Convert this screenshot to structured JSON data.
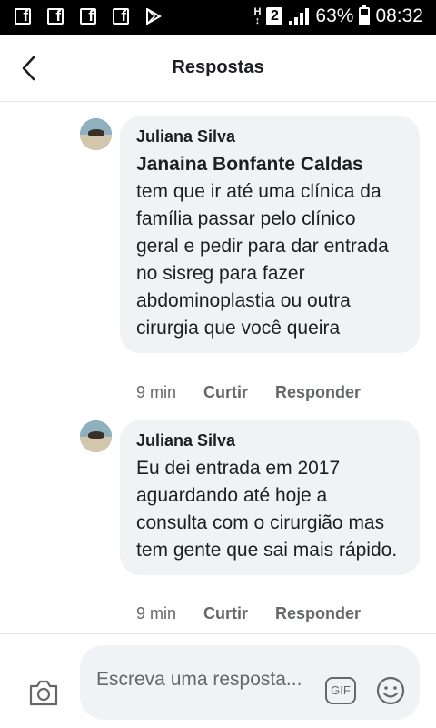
{
  "status_bar": {
    "battery": "63%",
    "battery_level": 0.63,
    "time": "08:32",
    "sim_badge": "2",
    "network_letter": "H",
    "notification_icons": [
      "facebook-icon",
      "facebook-icon",
      "facebook-icon",
      "facebook-icon",
      "play-store-icon"
    ]
  },
  "header": {
    "title": "Respostas",
    "back_icon": "chevron-left-icon"
  },
  "comments": [
    {
      "author": "Juliana Silva",
      "mention": "Janaina Bonfante Caldas",
      "text": "tem que ir até uma clínica da família passar pelo clínico geral e pedir para dar entrada no sisreg para fazer abdominoplastia ou outra cirurgia que você queira",
      "time": "9 min",
      "like_label": "Curtir",
      "reply_label": "Responder"
    },
    {
      "author": "Juliana Silva",
      "mention": "",
      "text": "Eu dei entrada em 2017 aguardando até hoje a consulta com o cirurgião mas tem gente que sai mais rápido.",
      "time": "9 min",
      "like_label": "Curtir",
      "reply_label": "Responder"
    }
  ],
  "composer": {
    "placeholder": "Escreva uma resposta...",
    "gif_label": "GIF",
    "camera_icon": "camera-icon",
    "emoji_icon": "emoji-icon"
  },
  "colors": {
    "bubble_bg": "#f0f2f5",
    "text_primary": "#1c1e21",
    "text_secondary": "#65676b"
  }
}
